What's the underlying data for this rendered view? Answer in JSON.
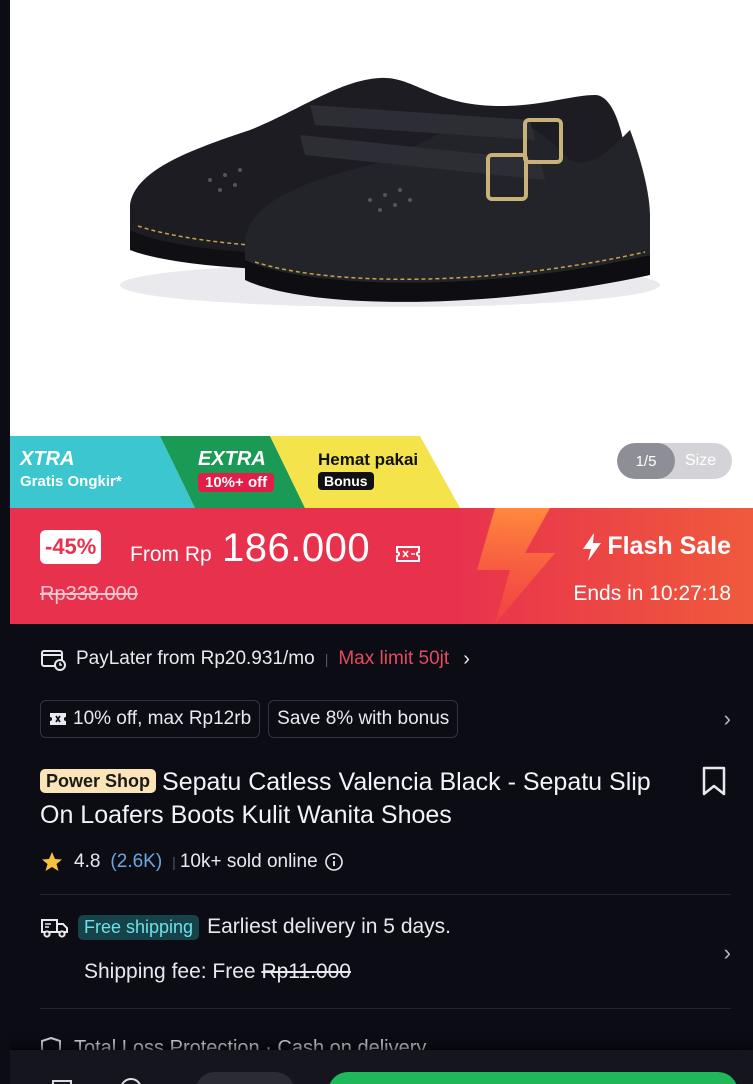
{
  "gallery": {
    "counter": "1/5",
    "size_label": "Size"
  },
  "promos": {
    "xtra": {
      "title": "XTRA",
      "sub": "Gratis Ongkir*"
    },
    "extra": {
      "title": "EXTRA",
      "sub": "10%+ off"
    },
    "hemat": {
      "title": "Hemat pakai",
      "sub": "Bonus"
    }
  },
  "flash": {
    "discount": "-45%",
    "from_label": "From Rp",
    "price": "186.000",
    "original_price": "Rp338.000",
    "label": "Flash Sale",
    "ends": "Ends in 10:27:18"
  },
  "paylater": {
    "text": "PayLater from Rp20.931/mo",
    "limit": "Max limit 50jt"
  },
  "vouchers": [
    "10% off, max Rp12rb",
    "Save 8% with bonus"
  ],
  "product": {
    "badge": "Power Shop",
    "title": "Sepatu Catless Valencia Black - Sepatu Slip On Loafers Boots Kulit Wanita Shoes"
  },
  "rating": {
    "score": "4.8",
    "count": "(2.6K)",
    "sold": "10k+ sold online"
  },
  "shipping": {
    "tag": "Free shipping",
    "eta": "Earliest delivery in 5 days.",
    "fee_label": "Shipping fee: Free",
    "fee_original": "Rp11.000"
  },
  "protection": {
    "text": "Total Loss Protection · Cash on delivery"
  },
  "colors": {
    "flash_red": "#e8324d",
    "xtra_teal": "#3cc6cf",
    "extra_green": "#1a9a54",
    "hemat_yellow": "#f5e34b",
    "buy_green": "#1eb85a"
  }
}
